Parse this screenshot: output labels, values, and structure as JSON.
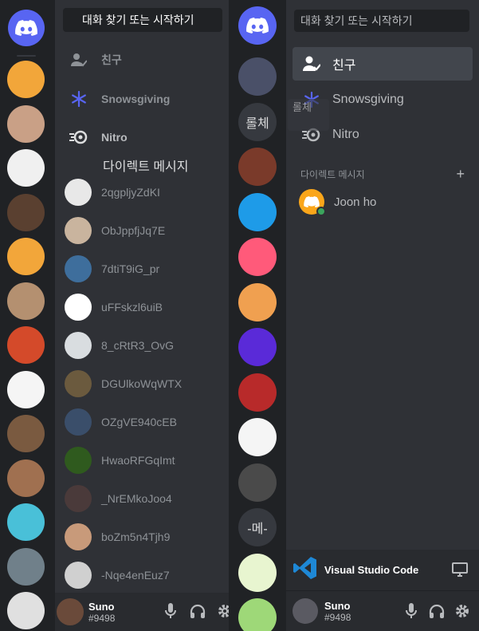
{
  "left": {
    "search_label": "대화 찾기 또는 시작하기",
    "nav": [
      {
        "label": "친구",
        "icon": "friends-icon"
      },
      {
        "label": "Snowsgiving",
        "icon": "snowflake-icon"
      },
      {
        "label": "Nitro",
        "icon": "nitro-icon"
      }
    ],
    "dm_header": "다이렉트 메시지",
    "dms": [
      {
        "name": "2qgpljyZdKI",
        "color": "#e8e8e8"
      },
      {
        "name": "ObJppfjJq7E",
        "color": "#c9b49e"
      },
      {
        "name": "7dtiT9iG_pr",
        "color": "#3e6e9c"
      },
      {
        "name": "uFFskzl6uiB",
        "color": "#ffffff"
      },
      {
        "name": "8_cRtR3_OvG",
        "color": "#d9dde0"
      },
      {
        "name": "DGUlkoWqWTX",
        "color": "#6b5a3e"
      },
      {
        "name": "OZgVE940cEB",
        "color": "#3a4e6a"
      },
      {
        "name": "HwaoRFGqImt",
        "color": "#2f5a1e"
      },
      {
        "name": "_NrEMkoJoo4",
        "color": "#4a3a3a"
      },
      {
        "name": "boZm5n4Tjh9",
        "color": "#c89a7a"
      },
      {
        "name": "-Nqe4enEuz7",
        "color": "#d0d0d0"
      }
    ],
    "rail_colors": [
      "#f2a63a",
      "#c9a086",
      "#f0f0f0",
      "#5a4030",
      "#f2a63a",
      "#b49070",
      "#d44a2a",
      "#f5f5f5",
      "#7a5a40",
      "#a07050",
      "#49c0d8",
      "#70808a",
      "#e0e0e0"
    ],
    "user": {
      "name": "Suno",
      "tag": "#9498"
    }
  },
  "right": {
    "search_label": "대화 찾기 또는 시작하기",
    "nav": [
      {
        "label": "친구",
        "icon": "friends-icon"
      },
      {
        "label": "Snowsgiving",
        "icon": "snowflake-icon"
      },
      {
        "label": "Nitro",
        "icon": "nitro-icon"
      }
    ],
    "tooltip_text": "롤체",
    "dm_header": "다이렉트 메시지",
    "dm_add": "+",
    "dm": {
      "name": "Joon ho"
    },
    "rail": [
      {
        "type": "image",
        "color": "#4a5068"
      },
      {
        "type": "text",
        "label": "롤체"
      },
      {
        "type": "image",
        "color": "#7a3a2a"
      },
      {
        "type": "image",
        "color": "#1e9be8"
      },
      {
        "type": "image",
        "color": "#ff5a7a"
      },
      {
        "type": "image",
        "color": "#f0a050"
      },
      {
        "type": "image",
        "color": "#5a2ad8"
      },
      {
        "type": "image",
        "color": "#b82a2a"
      },
      {
        "type": "image",
        "color": "#f5f5f5"
      },
      {
        "type": "image",
        "color": "#4a4a4a"
      },
      {
        "type": "text",
        "label": "-메-"
      },
      {
        "type": "image",
        "color": "#e8f5d0"
      },
      {
        "type": "image",
        "color": "#9ed878"
      }
    ],
    "activity": {
      "label": "Visual Studio Code"
    },
    "user": {
      "name": "Suno",
      "tag": "#9498"
    },
    "colors": {
      "blurple": "#5865f2",
      "online": "#3ba55d",
      "vscode": "#1e88d6"
    }
  }
}
